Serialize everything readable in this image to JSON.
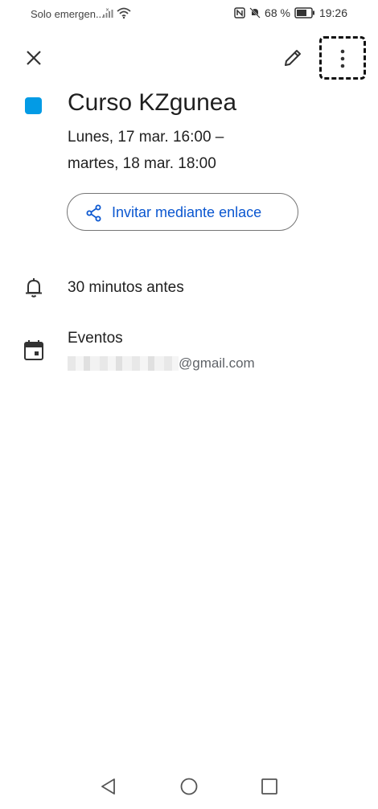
{
  "status_bar": {
    "carrier": "Solo emergen...",
    "battery_percent": "68 %",
    "time": "19:26"
  },
  "toolbar": {
    "close_icon": "close-icon",
    "edit_icon": "pencil-icon",
    "more_icon": "more-vert-icon"
  },
  "event": {
    "color": "#039be5",
    "title": "Curso KZgunea",
    "date_line_1": "Lunes, 17 mar. 16:00 –",
    "date_line_2": "martes, 18 mar. 18:00",
    "invite_label": "Invitar mediante enlace"
  },
  "reminder": {
    "text": "30 minutos antes"
  },
  "calendar": {
    "name": "Eventos",
    "account_suffix": "@gmail.com"
  },
  "colors": {
    "accent": "#0b57d0",
    "event_color": "#039be5"
  }
}
